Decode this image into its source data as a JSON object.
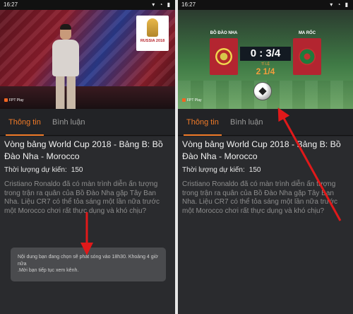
{
  "left": {
    "status": {
      "time": "16:27",
      "icons": "▾ ◔ ▮"
    },
    "video": {
      "logo_text": "RUSSIA 2018",
      "channel": "FPT Play"
    },
    "tabs": [
      {
        "label": "Thông tin",
        "active": true
      },
      {
        "label": "Bình luận",
        "active": false
      }
    ],
    "title": "Vòng bảng World Cup 2018 - Bảng B: Bồ Đào Nha - Morocco",
    "duration_label": "Thời lượng dự kiến:",
    "duration_value": "150",
    "description": "Cristiano Ronaldo đã có màn trình diễn ấn tượng trong trận ra quân của Bồ Đào Nha gặp Tây Ban Nha. Liệu CR7 có thể tỏa sáng một lần nữa trước một Morocco chơi rất thực dụng và khó chịu?",
    "toast_line1": "Nội dung bạn đang chọn sẽ phát sóng vào 18h30. Khoảng 4 giờ nữa",
    ".toast_line2": "",
    "toast_line2": ".Mời bạn tiếp tục xem kênh."
  },
  "right": {
    "status": {
      "time": "16:27",
      "icons": "▾ ◔ ▮"
    },
    "video": {
      "team_a": "BỒ ĐÀO NHA",
      "team_b": "MA RỐC",
      "score": "0 : 3/4",
      "score_label": "TỈ LỆ",
      "score_sub": "2 1/4",
      "channel": "FPT Play"
    },
    "tabs": [
      {
        "label": "Thông tin",
        "active": true
      },
      {
        "label": "Bình luận",
        "active": false
      }
    ],
    "title": "Vòng bảng World Cup 2018 - Bảng B: Bồ Đào Nha - Morocco",
    "duration_label": "Thời lượng dự kiến:",
    "duration_value": "150",
    "description": "Cristiano Ronaldo đã có màn trình diễn ấn tượng trong trận ra quân của Bồ Đào Nha gặp Tây Ban Nha. Liệu CR7 có thể tỏa sáng một lần nữa trước một Morocco chơi rất thực dụng và khó chịu?"
  },
  "colors": {
    "accent": "#f07a28",
    "background": "#2a2b2e",
    "annotation_arrow": "#e0191a"
  }
}
